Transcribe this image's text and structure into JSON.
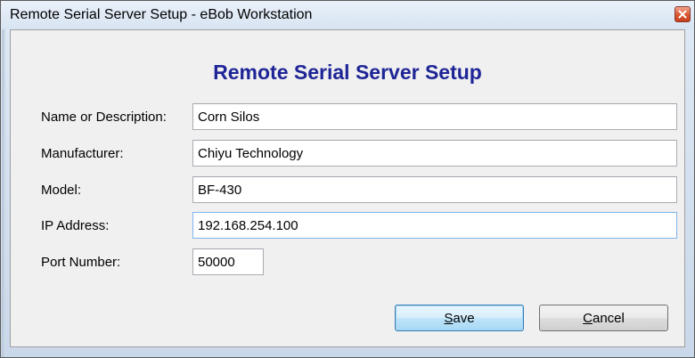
{
  "window": {
    "title": "Remote Serial Server Setup - eBob Workstation",
    "close_icon": "close-icon"
  },
  "dialog": {
    "heading": "Remote Serial Server Setup",
    "heading_color": "#1e2596"
  },
  "fields": {
    "name": {
      "label": "Name or Description:",
      "value": "Corn Silos"
    },
    "manufacturer": {
      "label": "Manufacturer:",
      "value": "Chiyu Technology"
    },
    "model": {
      "label": "Model:",
      "value": "BF-430"
    },
    "ip": {
      "label": "IP Address:",
      "value": "192.168.254.100"
    },
    "port": {
      "label": "Port Number:",
      "value": "50000"
    }
  },
  "buttons": {
    "save": "Save",
    "cancel": "Cancel"
  }
}
